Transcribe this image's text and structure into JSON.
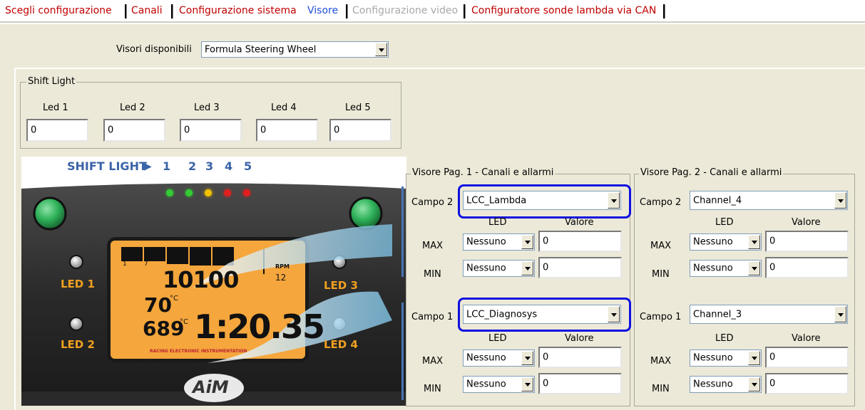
{
  "tabs": [
    {
      "label": "Scegli configurazione",
      "state": "normal"
    },
    {
      "label": "Canali",
      "state": "normal"
    },
    {
      "label": "Configurazione sistema",
      "state": "normal"
    },
    {
      "label": "Visore",
      "state": "active"
    },
    {
      "label": "Configurazione video",
      "state": "disabled"
    },
    {
      "label": "Configuratore sonde lambda via CAN",
      "state": "normal"
    }
  ],
  "viewer_select": {
    "label": "Visori disponibili",
    "value": "Formula Steering Wheel"
  },
  "shift_light": {
    "title": "Shift Light",
    "leds": [
      {
        "label": "Led 1",
        "value": "0"
      },
      {
        "label": "Led 2",
        "value": "0"
      },
      {
        "label": "Led 3",
        "value": "0"
      },
      {
        "label": "Led 4",
        "value": "0"
      },
      {
        "label": "Led 5",
        "value": "0"
      }
    ]
  },
  "wheel_image": {
    "shift_light_caption": "SHIFT LIGHT",
    "shift_numbers": [
      "1",
      "2",
      "3",
      "4",
      "5"
    ],
    "led_labels": [
      "LED 1",
      "LED 2",
      "LED 3",
      "LED 4"
    ],
    "display": {
      "rpm": "10100",
      "temp1": "70",
      "temp2": "689",
      "unit": "°C",
      "laptime": "1:20.35",
      "gear": "12",
      "rpm_label": "RPM",
      "scale": [
        "1",
        "7"
      ],
      "brand_text": "RACING ELECTRONIC INSTRUMENTATION"
    },
    "logo": "AiM",
    "shift_led_colors": [
      "#33cc33",
      "#33cc33",
      "#f2c200",
      "#e02020",
      "#e02020"
    ]
  },
  "page1": {
    "title": "Visore Pag. 1 - Canali e allarmi",
    "fields": [
      {
        "name": "Campo 2",
        "value": "LCC_Lambda",
        "led_header": "LED",
        "valore_header": "Valore",
        "max": {
          "label": "MAX",
          "led": "Nessuno",
          "value": "0"
        },
        "min": {
          "label": "MIN",
          "led": "Nessuno",
          "value": "0"
        }
      },
      {
        "name": "Campo 1",
        "value": "LCC_Diagnosys",
        "led_header": "LED",
        "valore_header": "Valore",
        "max": {
          "label": "MAX",
          "led": "Nessuno",
          "value": "0"
        },
        "min": {
          "label": "MIN",
          "led": "Nessuno",
          "value": "0"
        }
      }
    ]
  },
  "page2": {
    "title": "Visore Pag. 2 - Canali e allarmi",
    "fields": [
      {
        "name": "Campo 2",
        "value": "Channel_4",
        "led_header": "LED",
        "valore_header": "Valore",
        "max": {
          "label": "MAX",
          "led": "Nessuno",
          "value": "0"
        },
        "min": {
          "label": "MIN",
          "led": "Nessuno",
          "value": "0"
        }
      },
      {
        "name": "Campo 1",
        "value": "Channel_3",
        "led_header": "LED",
        "valore_header": "Valore",
        "max": {
          "label": "MAX",
          "led": "Nessuno",
          "value": "0"
        },
        "min": {
          "label": "MIN",
          "led": "Nessuno",
          "value": "0"
        }
      }
    ]
  },
  "colors": {
    "tab_red": "#c00000",
    "tab_active": "#1f4fd8",
    "highlight": "#1010e0",
    "display_orange": "#f5a63c"
  }
}
